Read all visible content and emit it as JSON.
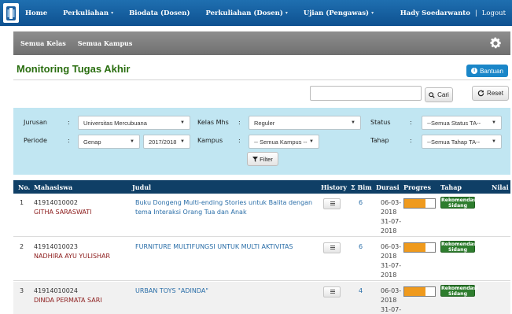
{
  "nav": {
    "home": "Home",
    "perkuliahan": "Perkuliahan",
    "biodata": "Biodata (Dosen)",
    "perkuliahan_dosen": "Perkuliahan (Dosen)",
    "ujian": "Ujian (Pengawas)",
    "user": "Hady Soedarwanto",
    "separator": "|",
    "logout": "Logout"
  },
  "subnav": {
    "semua_kelas": "Semua Kelas",
    "semua_kampus": "Semua Kampus"
  },
  "page": {
    "title": "Monitoring Tugas Akhir",
    "bantuan": "Bantuan"
  },
  "search": {
    "value": "",
    "cari": "Cari",
    "reset": "Reset"
  },
  "filter": {
    "jurusan_label": "Jurusan",
    "jurusan_value": "Universitas Mercubuana",
    "periode_label": "Periode",
    "periode_value": "Genap",
    "tahun_value": "2017/2018",
    "kelas_label": "Kelas Mhs",
    "kelas_value": "Reguler",
    "kampus_label": "Kampus",
    "kampus_value": "-- Semua Kampus --",
    "status_label": "Status",
    "status_value": "--Semua Status TA--",
    "tahap_label": "Tahap",
    "tahap_value": "--Semua Tahap TA--",
    "filter_button": "Filter",
    "colon": ":"
  },
  "table": {
    "headers": {
      "no": "No.",
      "mahasiswa": "Mahasiswa",
      "judul": "Judul",
      "history": "History",
      "bim": "Σ Bim",
      "durasi": "Durasi",
      "progres": "Progres",
      "tahap": "Tahap",
      "nilai": "Nilai"
    },
    "rows": [
      {
        "no": "1",
        "nim": "41914010002",
        "nama": "GITHA SARASWATI",
        "judul_1": "Buku Dongeng Multi-ending Stories untuk Balita dengan",
        "judul_2": "tema Interaksi Orang Tua dan Anak",
        "bim": "6",
        "durasi_1": "06-03-",
        "durasi_2": "2018",
        "durasi_3": "31-07-",
        "durasi_4": "2018",
        "progress": 0.7,
        "tahap_1": "Rekomendasi",
        "tahap_2": "Sidang"
      },
      {
        "no": "2",
        "nim": "41914010023",
        "nama": "NADHIRA AYU YULISHAR",
        "judul_1": "FURNITURE MULTIFUNGSI UNTUK MULTI AKTIVITAS",
        "judul_2": "",
        "bim": "6",
        "durasi_1": "06-03-",
        "durasi_2": "2018",
        "durasi_3": "31-07-",
        "durasi_4": "2018",
        "progress": 0.7,
        "tahap_1": "Rekomendasi",
        "tahap_2": "Sidang"
      },
      {
        "no": "3",
        "nim": "41914010024",
        "nama": "DINDA PERMATA SARI",
        "judul_1": "URBAN TOYS \"ADINDA\"",
        "judul_2": "",
        "bim": "4",
        "durasi_1": "06-03-",
        "durasi_2": "2018",
        "durasi_3": "31-07-",
        "durasi_4": "",
        "progress": 0.7,
        "tahap_1": "Rekomendasi",
        "tahap_2": "Sidang"
      }
    ]
  }
}
